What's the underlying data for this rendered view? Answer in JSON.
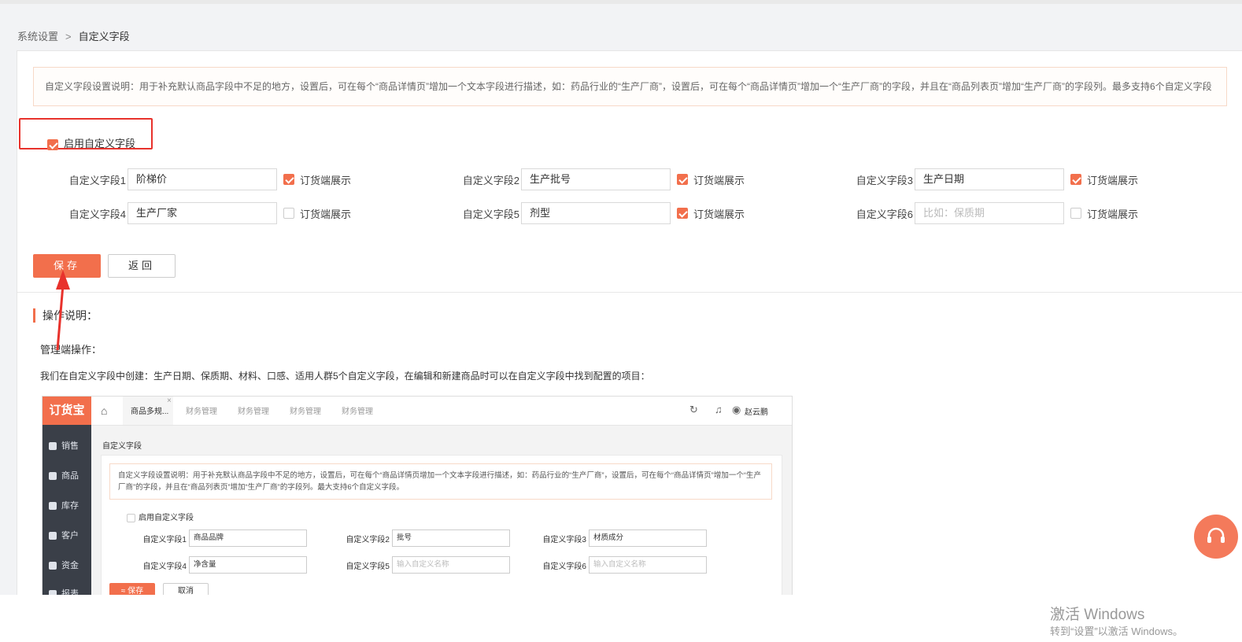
{
  "breadcrumb": {
    "root": "系统设置",
    "separator": ">",
    "current": "自定义字段"
  },
  "notice": "自定义字段设置说明：用于补充默认商品字段中不足的地方，设置后，可在每个“商品详情页”增加一个文本字段进行描述，如：药品行业的“生产厂商”，设置后，可在每个“商品详情页”增加一个“生产厂商”的字段，并且在“商品列表页”增加“生产厂商”的字段列。最多支持6个自定义字段",
  "enable": {
    "label": "启用自定义字段",
    "checked": true
  },
  "show_label": "订货端展示",
  "fields": [
    {
      "label": "自定义字段1",
      "value": "阶梯价",
      "placeholder": "",
      "show": true
    },
    {
      "label": "自定义字段2",
      "value": "生产批号",
      "placeholder": "",
      "show": true
    },
    {
      "label": "自定义字段3",
      "value": "生产日期",
      "placeholder": "",
      "show": true
    },
    {
      "label": "自定义字段4",
      "value": "生产厂家",
      "placeholder": "",
      "show": false
    },
    {
      "label": "自定义字段5",
      "value": "剂型",
      "placeholder": "",
      "show": true
    },
    {
      "label": "自定义字段6",
      "value": "",
      "placeholder": "比如：保质期",
      "show": false
    }
  ],
  "buttons": {
    "save": "保存",
    "back": "返回"
  },
  "operation": {
    "title": "操作说明：",
    "subtitle": "管理端操作：",
    "description": "我们在自定义字段中创建：生产日期、保质期、材料、口感、适用人群5个自定义字段，在编辑和新建商品时可以在自定义字段中找到配置的项目："
  },
  "example": {
    "logo": "订货宝",
    "menu": [
      "销售",
      "商品",
      "库存",
      "客户",
      "资金",
      "报表"
    ],
    "tabs": [
      "商品多规...",
      "财务管理",
      "财务管理",
      "财务管理",
      "财务管理"
    ],
    "tab_close": "×",
    "user": "赵云鹏",
    "page_title": "自定义字段",
    "notice": "自定义字段设置说明：用于补充默认商品字段中不足的地方，设置后，可在每个“商品详情页增加一个文本字段进行描述，如：药品行业的“生产厂商”，设置后，可在每个“商品详情页”增加一个“生产厂商”的字段，并且在“商品列表页”增加“生产厂商”的字段列。最大支持6个自定义字段。",
    "enable_label": "启用自定义字段",
    "fields": [
      {
        "label": "自定义字段1",
        "value": "商品品牌",
        "placeholder": ""
      },
      {
        "label": "自定义字段2",
        "value": "批号",
        "placeholder": ""
      },
      {
        "label": "自定义字段3",
        "value": "材质成分",
        "placeholder": ""
      },
      {
        "label": "自定义字段4",
        "value": "净含量",
        "placeholder": ""
      },
      {
        "label": "自定义字段5",
        "value": "",
        "placeholder": "输入自定义名称"
      },
      {
        "label": "自定义字段6",
        "value": "",
        "placeholder": "输入自定义名称"
      }
    ],
    "save": "≈ 保存",
    "cancel": "取消"
  },
  "windows_activation": {
    "title": "激活 Windows",
    "subtitle": "转到“设置”以激活 Windows。"
  },
  "colors": {
    "accent": "#f26f4c",
    "highlight_border": "#e8322c",
    "sidebar": "#3a3f48"
  }
}
